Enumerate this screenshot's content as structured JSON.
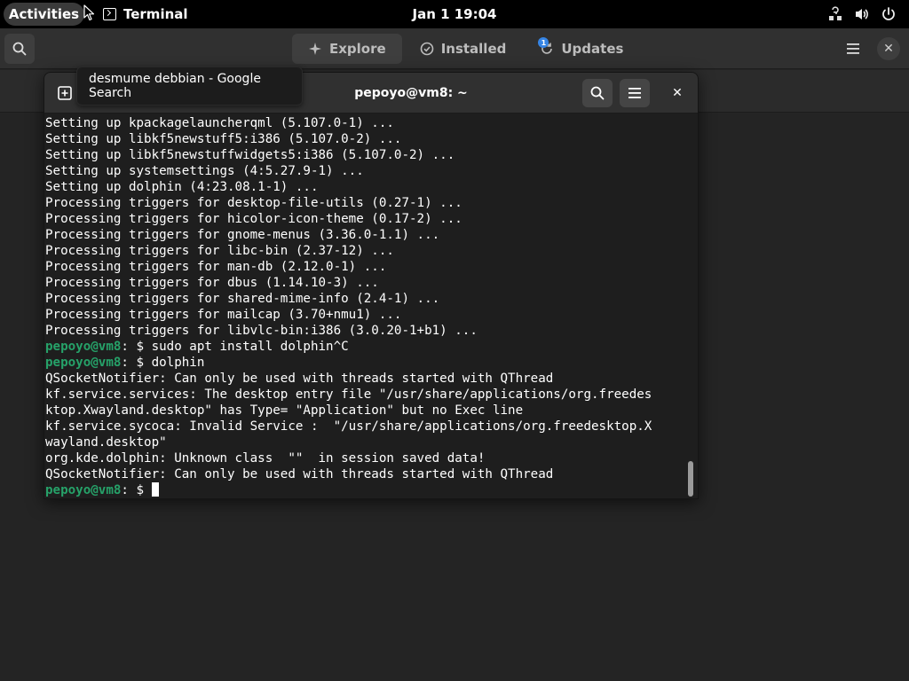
{
  "topbar": {
    "activities_label": "Activities",
    "app_label": "Terminal",
    "clock": "Jan 1  19:04"
  },
  "software": {
    "tabs": [
      {
        "label": "Explore",
        "icon": "sparkle-icon",
        "active": true
      },
      {
        "label": "Installed",
        "icon": "check-circle-icon",
        "active": false
      },
      {
        "label": "Updates",
        "icon": "refresh-icon",
        "active": false,
        "badge": "1"
      }
    ]
  },
  "tooltip": {
    "text": "desmume debbian - Google Search"
  },
  "terminal": {
    "title": "pepoyo@vm8: ~",
    "prompt_user": "pepoyo@vm8",
    "prompt_suffix": ": $ ",
    "lines": [
      {
        "type": "out",
        "text": "Setting up kpackagelauncherqml (5.107.0-1) ..."
      },
      {
        "type": "out",
        "text": "Setting up libkf5newstuff5:i386 (5.107.0-2) ..."
      },
      {
        "type": "out",
        "text": "Setting up libkf5newstuffwidgets5:i386 (5.107.0-2) ..."
      },
      {
        "type": "out",
        "text": "Setting up systemsettings (4:5.27.9-1) ..."
      },
      {
        "type": "out",
        "text": "Setting up dolphin (4:23.08.1-1) ..."
      },
      {
        "type": "out",
        "text": "Processing triggers for desktop-file-utils (0.27-1) ..."
      },
      {
        "type": "out",
        "text": "Processing triggers for hicolor-icon-theme (0.17-2) ..."
      },
      {
        "type": "out",
        "text": "Processing triggers for gnome-menus (3.36.0-1.1) ..."
      },
      {
        "type": "out",
        "text": "Processing triggers for libc-bin (2.37-12) ..."
      },
      {
        "type": "out",
        "text": "Processing triggers for man-db (2.12.0-1) ..."
      },
      {
        "type": "out",
        "text": "Processing triggers for dbus (1.14.10-3) ..."
      },
      {
        "type": "out",
        "text": "Processing triggers for shared-mime-info (2.4-1) ..."
      },
      {
        "type": "out",
        "text": "Processing triggers for mailcap (3.70+nmu1) ..."
      },
      {
        "type": "out",
        "text": "Processing triggers for libvlc-bin:i386 (3.0.20-1+b1) ..."
      },
      {
        "type": "prompt",
        "text": "sudo apt install dolphin^C"
      },
      {
        "type": "prompt",
        "text": "dolphin"
      },
      {
        "type": "out",
        "text": "QSocketNotifier: Can only be used with threads started with QThread"
      },
      {
        "type": "out",
        "text": "kf.service.services: The desktop entry file \"/usr/share/applications/org.freedes"
      },
      {
        "type": "out",
        "text": "ktop.Xwayland.desktop\" has Type= \"Application\" but no Exec line"
      },
      {
        "type": "out",
        "text": "kf.service.sycoca: Invalid Service :  \"/usr/share/applications/org.freedesktop.X"
      },
      {
        "type": "out",
        "text": "wayland.desktop\""
      },
      {
        "type": "out",
        "text": "org.kde.dolphin: Unknown class  \"\"  in session saved data!"
      },
      {
        "type": "out",
        "text": "QSocketNotifier: Can only be used with threads started with QThread"
      },
      {
        "type": "prompt",
        "text": "",
        "cursor": true
      }
    ]
  }
}
